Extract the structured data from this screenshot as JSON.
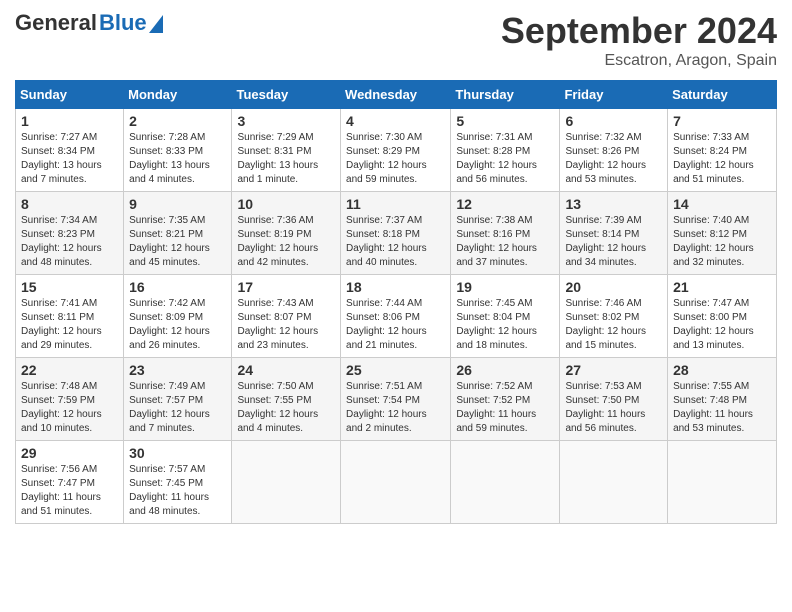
{
  "header": {
    "logo_general": "General",
    "logo_blue": "Blue",
    "month_title": "September 2024",
    "location": "Escatron, Aragon, Spain"
  },
  "days_of_week": [
    "Sunday",
    "Monday",
    "Tuesday",
    "Wednesday",
    "Thursday",
    "Friday",
    "Saturday"
  ],
  "weeks": [
    [
      {
        "day": "1",
        "info": "Sunrise: 7:27 AM\nSunset: 8:34 PM\nDaylight: 13 hours\nand 7 minutes."
      },
      {
        "day": "2",
        "info": "Sunrise: 7:28 AM\nSunset: 8:33 PM\nDaylight: 13 hours\nand 4 minutes."
      },
      {
        "day": "3",
        "info": "Sunrise: 7:29 AM\nSunset: 8:31 PM\nDaylight: 13 hours\nand 1 minute."
      },
      {
        "day": "4",
        "info": "Sunrise: 7:30 AM\nSunset: 8:29 PM\nDaylight: 12 hours\nand 59 minutes."
      },
      {
        "day": "5",
        "info": "Sunrise: 7:31 AM\nSunset: 8:28 PM\nDaylight: 12 hours\nand 56 minutes."
      },
      {
        "day": "6",
        "info": "Sunrise: 7:32 AM\nSunset: 8:26 PM\nDaylight: 12 hours\nand 53 minutes."
      },
      {
        "day": "7",
        "info": "Sunrise: 7:33 AM\nSunset: 8:24 PM\nDaylight: 12 hours\nand 51 minutes."
      }
    ],
    [
      {
        "day": "8",
        "info": "Sunrise: 7:34 AM\nSunset: 8:23 PM\nDaylight: 12 hours\nand 48 minutes."
      },
      {
        "day": "9",
        "info": "Sunrise: 7:35 AM\nSunset: 8:21 PM\nDaylight: 12 hours\nand 45 minutes."
      },
      {
        "day": "10",
        "info": "Sunrise: 7:36 AM\nSunset: 8:19 PM\nDaylight: 12 hours\nand 42 minutes."
      },
      {
        "day": "11",
        "info": "Sunrise: 7:37 AM\nSunset: 8:18 PM\nDaylight: 12 hours\nand 40 minutes."
      },
      {
        "day": "12",
        "info": "Sunrise: 7:38 AM\nSunset: 8:16 PM\nDaylight: 12 hours\nand 37 minutes."
      },
      {
        "day": "13",
        "info": "Sunrise: 7:39 AM\nSunset: 8:14 PM\nDaylight: 12 hours\nand 34 minutes."
      },
      {
        "day": "14",
        "info": "Sunrise: 7:40 AM\nSunset: 8:12 PM\nDaylight: 12 hours\nand 32 minutes."
      }
    ],
    [
      {
        "day": "15",
        "info": "Sunrise: 7:41 AM\nSunset: 8:11 PM\nDaylight: 12 hours\nand 29 minutes."
      },
      {
        "day": "16",
        "info": "Sunrise: 7:42 AM\nSunset: 8:09 PM\nDaylight: 12 hours\nand 26 minutes."
      },
      {
        "day": "17",
        "info": "Sunrise: 7:43 AM\nSunset: 8:07 PM\nDaylight: 12 hours\nand 23 minutes."
      },
      {
        "day": "18",
        "info": "Sunrise: 7:44 AM\nSunset: 8:06 PM\nDaylight: 12 hours\nand 21 minutes."
      },
      {
        "day": "19",
        "info": "Sunrise: 7:45 AM\nSunset: 8:04 PM\nDaylight: 12 hours\nand 18 minutes."
      },
      {
        "day": "20",
        "info": "Sunrise: 7:46 AM\nSunset: 8:02 PM\nDaylight: 12 hours\nand 15 minutes."
      },
      {
        "day": "21",
        "info": "Sunrise: 7:47 AM\nSunset: 8:00 PM\nDaylight: 12 hours\nand 13 minutes."
      }
    ],
    [
      {
        "day": "22",
        "info": "Sunrise: 7:48 AM\nSunset: 7:59 PM\nDaylight: 12 hours\nand 10 minutes."
      },
      {
        "day": "23",
        "info": "Sunrise: 7:49 AM\nSunset: 7:57 PM\nDaylight: 12 hours\nand 7 minutes."
      },
      {
        "day": "24",
        "info": "Sunrise: 7:50 AM\nSunset: 7:55 PM\nDaylight: 12 hours\nand 4 minutes."
      },
      {
        "day": "25",
        "info": "Sunrise: 7:51 AM\nSunset: 7:54 PM\nDaylight: 12 hours\nand 2 minutes."
      },
      {
        "day": "26",
        "info": "Sunrise: 7:52 AM\nSunset: 7:52 PM\nDaylight: 11 hours\nand 59 minutes."
      },
      {
        "day": "27",
        "info": "Sunrise: 7:53 AM\nSunset: 7:50 PM\nDaylight: 11 hours\nand 56 minutes."
      },
      {
        "day": "28",
        "info": "Sunrise: 7:55 AM\nSunset: 7:48 PM\nDaylight: 11 hours\nand 53 minutes."
      }
    ],
    [
      {
        "day": "29",
        "info": "Sunrise: 7:56 AM\nSunset: 7:47 PM\nDaylight: 11 hours\nand 51 minutes."
      },
      {
        "day": "30",
        "info": "Sunrise: 7:57 AM\nSunset: 7:45 PM\nDaylight: 11 hours\nand 48 minutes."
      },
      {
        "day": "",
        "info": ""
      },
      {
        "day": "",
        "info": ""
      },
      {
        "day": "",
        "info": ""
      },
      {
        "day": "",
        "info": ""
      },
      {
        "day": "",
        "info": ""
      }
    ]
  ]
}
